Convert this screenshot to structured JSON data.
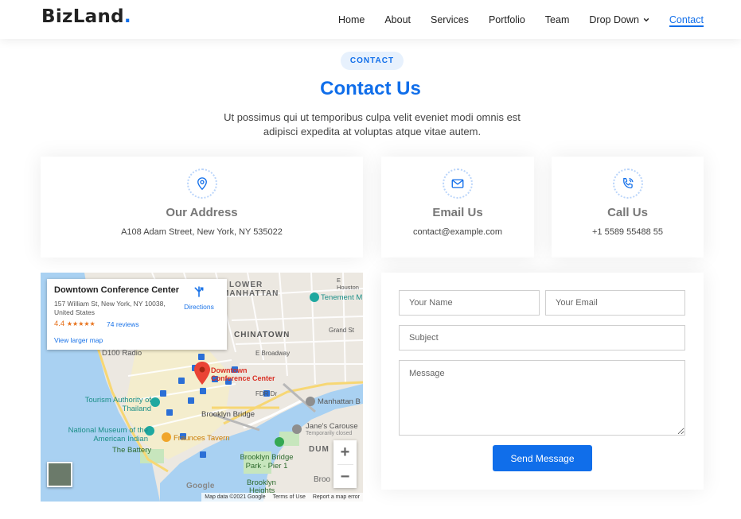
{
  "header": {
    "logo_text": "BizLand",
    "logo_dot": ".",
    "nav": [
      {
        "label": "Home"
      },
      {
        "label": "About"
      },
      {
        "label": "Services"
      },
      {
        "label": "Portfolio"
      },
      {
        "label": "Team"
      },
      {
        "label": "Drop Down"
      },
      {
        "label": "Contact"
      }
    ]
  },
  "section": {
    "tag": "CONTACT",
    "title": "Contact Us",
    "description": "Ut possimus qui ut temporibus culpa velit eveniet modi omnis est adipisci expedita at voluptas atque vitae autem."
  },
  "info": {
    "address": {
      "title": "Our Address",
      "text": "A108 Adam Street, New York, NY 535022",
      "icon": "map-pin-icon"
    },
    "email": {
      "title": "Email Us",
      "text": "contact@example.com",
      "icon": "envelope-icon"
    },
    "phone": {
      "title": "Call Us",
      "text": "+1 5589 55488 55",
      "icon": "phone-icon"
    }
  },
  "map": {
    "place_title": "Downtown Conference Center",
    "place_address": "157 William St, New York, NY 10038, United States",
    "rating": "4.4",
    "stars": "★★★★★",
    "reviews": "74 reviews",
    "directions": "Directions",
    "view_larger": "View larger map",
    "google": "Google",
    "zoom_in": "+",
    "zoom_out": "−",
    "footer": {
      "data": "Map data ©2021 Google",
      "terms": "Terms of Use",
      "report": "Report a map error"
    },
    "labels": {
      "pin": "Downtown Conference Center",
      "chinatown": "CHINATOWN",
      "lower": "LOWER",
      "manhattan": "MANHATTAN",
      "tenement": "Tenement M",
      "tourism": "Tourism Authority of Thailand",
      "museum": "National Museum of the American Indian",
      "battery": "The Battery",
      "fraunces": "Fraunces Tavern",
      "brooklyn_bridge": "Brooklyn Bridge",
      "bb_park": "Brooklyn Bridge Park - Pier 1",
      "manhattan_bridge": "Manhattan B",
      "janes": "Jane's Carouse",
      "temp_closed": "Temporarily closed",
      "d100": "D100 Radio",
      "fdr": "FDR Dr",
      "dum": "DUM",
      "broo": "Broo",
      "brooklyn": "Brooklyn",
      "heights": "Heights",
      "e_broadway": "E Broadway",
      "grand": "Grand St",
      "houston": "E Houston"
    }
  },
  "form": {
    "name_placeholder": "Your Name",
    "email_placeholder": "Your Email",
    "subject_placeholder": "Subject",
    "message_placeholder": "Message",
    "submit_label": "Send Message"
  },
  "colors": {
    "accent": "#106eea",
    "title_gray": "#777777",
    "pin_red": "#ea4335"
  }
}
